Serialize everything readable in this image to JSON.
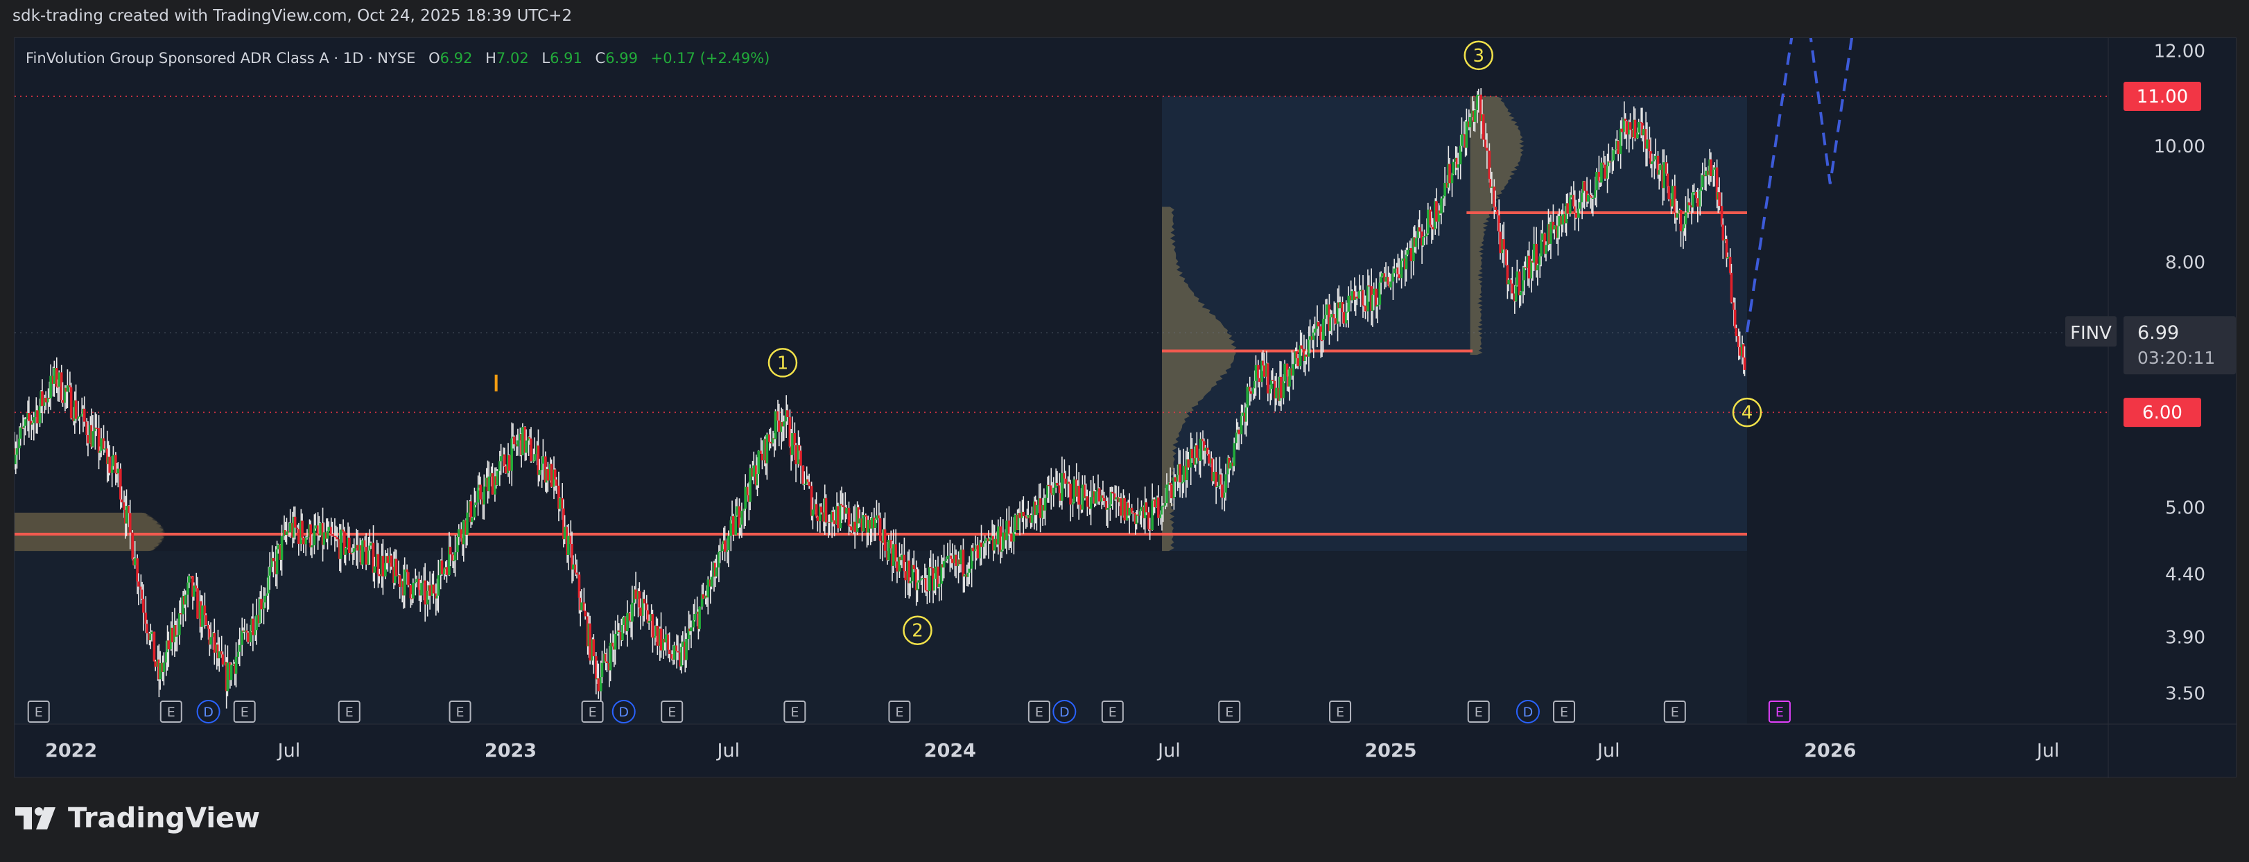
{
  "header": {
    "text": "sdk-trading created with TradingView.com, Oct 24, 2025 18:39 UTC+2"
  },
  "legend": {
    "symbol": "FinVolution Group Sponsored ADR Class A · 1D · NYSE",
    "o_label": "O",
    "o_value": "6.92",
    "h_label": "H",
    "h_value": "7.02",
    "l_label": "L",
    "l_value": "6.91",
    "c_label": "C",
    "c_value": "6.99",
    "change": "+0.17 (+2.49%)"
  },
  "colors": {
    "background": "#151c29",
    "up": "#22ab3a",
    "down": "#e0202a",
    "wick": "#e8e8e8",
    "level": "#f05a4f",
    "label_red": "#f23645",
    "wave": "#f2e24a",
    "projection": "#3d5bd9",
    "volume_profile": "#8b7a52"
  },
  "chart_data": {
    "type": "candlestick",
    "symbol_tag": "FINV",
    "last_price": "6.99",
    "countdown": "03:20:11",
    "y_axis": {
      "scale": "log",
      "range": [
        3.3,
        12.3
      ],
      "ticks": [
        "12.00",
        "10.00",
        "8.00",
        "5.00",
        "4.40",
        "3.90",
        "3.50"
      ]
    },
    "x_axis": {
      "range": [
        "2021-11-15",
        "2026-08-20"
      ],
      "ticks": [
        {
          "label": "2022",
          "date": "2022-01-01",
          "bold": true
        },
        {
          "label": "Jul",
          "date": "2022-07-01",
          "bold": false
        },
        {
          "label": "2023",
          "date": "2023-01-01",
          "bold": true
        },
        {
          "label": "Jul",
          "date": "2023-07-01",
          "bold": false
        },
        {
          "label": "2024",
          "date": "2024-01-01",
          "bold": true
        },
        {
          "label": "Jul",
          "date": "2024-07-01",
          "bold": false
        },
        {
          "label": "2025",
          "date": "2025-01-01",
          "bold": true
        },
        {
          "label": "Jul",
          "date": "2025-07-01",
          "bold": false
        },
        {
          "label": "2026",
          "date": "2026-01-01",
          "bold": true
        },
        {
          "label": "Jul",
          "date": "2026-07-01",
          "bold": false
        }
      ]
    },
    "price_path": [
      [
        "2021-11-15",
        5.6
      ],
      [
        "2021-12-20",
        6.4
      ],
      [
        "2022-02-10",
        5.3
      ],
      [
        "2022-03-15",
        3.6
      ],
      [
        "2022-04-10",
        4.3
      ],
      [
        "2022-05-10",
        3.6
      ],
      [
        "2022-06-05",
        4.1
      ],
      [
        "2022-07-01",
        4.8
      ],
      [
        "2022-09-01",
        4.6
      ],
      [
        "2022-10-25",
        4.2
      ],
      [
        "2022-12-01",
        5.0
      ],
      [
        "2023-01-10",
        5.7
      ],
      [
        "2023-02-05",
        5.3
      ],
      [
        "2023-03-15",
        3.6
      ],
      [
        "2023-04-15",
        4.2
      ],
      [
        "2023-05-20",
        3.7
      ],
      [
        "2023-06-20",
        4.4
      ],
      [
        "2023-07-25",
        5.4
      ],
      [
        "2023-08-15",
        6.0
      ],
      [
        "2023-09-10",
        5.0
      ],
      [
        "2023-11-01",
        4.8
      ],
      [
        "2023-12-05",
        4.3
      ],
      [
        "2024-02-01",
        4.6
      ],
      [
        "2024-04-01",
        5.2
      ],
      [
        "2024-06-15",
        4.9
      ],
      [
        "2024-07-25",
        5.6
      ],
      [
        "2024-08-15",
        5.2
      ],
      [
        "2024-09-10",
        6.5
      ],
      [
        "2024-10-01",
        6.3
      ],
      [
        "2024-11-10",
        7.2
      ],
      [
        "2024-12-20",
        7.5
      ],
      [
        "2025-02-05",
        8.7
      ],
      [
        "2025-03-15",
        10.9
      ],
      [
        "2025-04-10",
        7.5
      ],
      [
        "2025-05-15",
        8.5
      ],
      [
        "2025-06-20",
        9.3
      ],
      [
        "2025-07-20",
        10.5
      ],
      [
        "2025-08-10",
        9.8
      ],
      [
        "2025-09-01",
        8.6
      ],
      [
        "2025-09-25",
        9.7
      ],
      [
        "2025-10-22",
        6.5
      ],
      [
        "2025-10-24",
        6.99
      ]
    ],
    "levels": [
      {
        "price": 4.75,
        "from": "2021-11-15",
        "to": "2025-10-24"
      },
      {
        "price": 6.75,
        "from": "2024-06-25",
        "to": "2025-03-10"
      },
      {
        "price": 8.8,
        "from": "2025-03-05",
        "to": "2025-10-24"
      }
    ],
    "dotted_levels": [
      {
        "price": 11.0,
        "label": "11.00"
      },
      {
        "price": 6.0,
        "label": "6.00"
      }
    ],
    "wave_labels": [
      {
        "label": "1",
        "date": "2023-08-15",
        "price": 6.6
      },
      {
        "label": "2",
        "date": "2023-12-05",
        "price": 3.95
      },
      {
        "label": "3",
        "date": "2025-03-15",
        "price": 11.9
      },
      {
        "label": "4",
        "date": "2025-10-24",
        "price": 6.0
      }
    ],
    "projection": [
      {
        "points": [
          [
            "2025-10-24",
            7.0
          ],
          [
            "2025-12-01",
            12.5
          ]
        ]
      },
      {
        "points": [
          [
            "2025-12-15",
            12.5
          ],
          [
            "2026-01-01",
            9.3
          ],
          [
            "2026-01-20",
            12.5
          ]
        ]
      }
    ],
    "event_markers": [
      {
        "date": "2021-12-05",
        "type": "E"
      },
      {
        "date": "2022-03-25",
        "type": "E"
      },
      {
        "date": "2022-04-25",
        "type": "D"
      },
      {
        "date": "2022-05-25",
        "type": "E"
      },
      {
        "date": "2022-08-20",
        "type": "E"
      },
      {
        "date": "2022-11-20",
        "type": "E"
      },
      {
        "date": "2023-03-10",
        "type": "E"
      },
      {
        "date": "2023-04-05",
        "type": "D"
      },
      {
        "date": "2023-05-15",
        "type": "E"
      },
      {
        "date": "2023-08-25",
        "type": "E"
      },
      {
        "date": "2023-11-20",
        "type": "E"
      },
      {
        "date": "2024-03-15",
        "type": "E"
      },
      {
        "date": "2024-04-05",
        "type": "D"
      },
      {
        "date": "2024-05-15",
        "type": "E"
      },
      {
        "date": "2024-08-20",
        "type": "E"
      },
      {
        "date": "2024-11-20",
        "type": "E"
      },
      {
        "date": "2025-03-15",
        "type": "E"
      },
      {
        "date": "2025-04-25",
        "type": "D"
      },
      {
        "date": "2025-05-25",
        "type": "E"
      },
      {
        "date": "2025-08-25",
        "type": "E"
      },
      {
        "date": "2025-11-20",
        "type": "E",
        "upcoming": true
      }
    ]
  },
  "footer": {
    "brand": "TradingView"
  }
}
